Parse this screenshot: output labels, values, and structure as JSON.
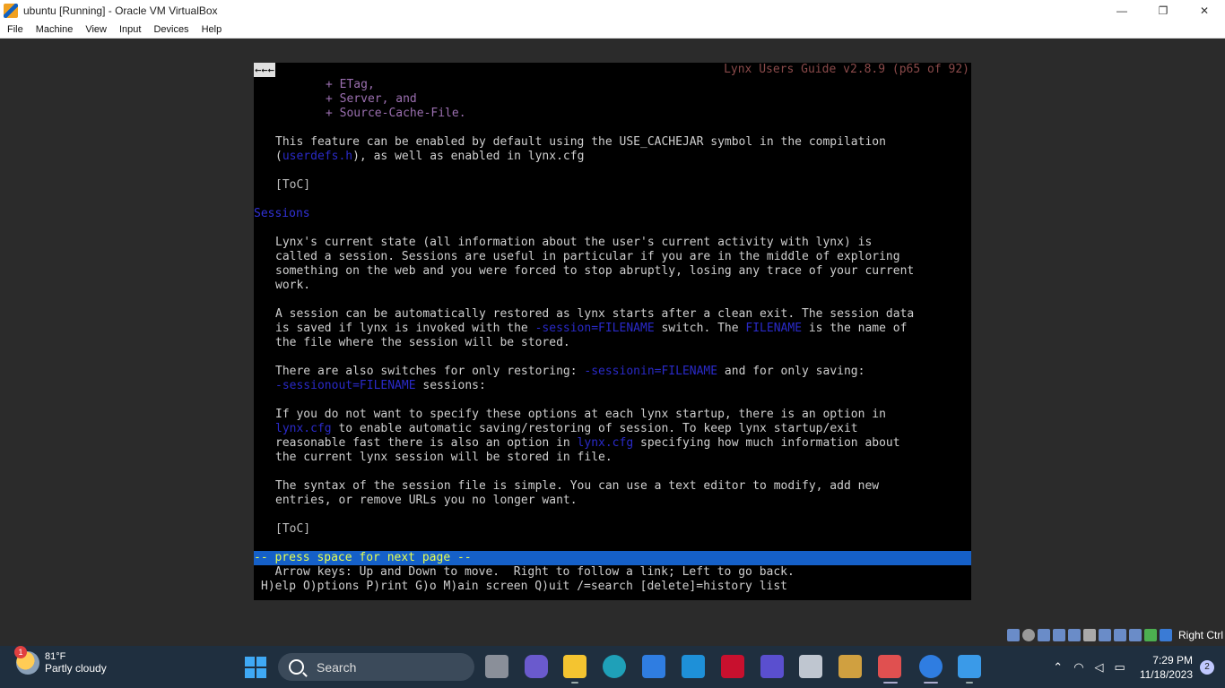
{
  "window": {
    "title": "ubuntu [Running] - Oracle VM VirtualBox",
    "minimize": "—",
    "restore": "❐",
    "close": "✕"
  },
  "menu": [
    "File",
    "Machine",
    "View",
    "Input",
    "Devices",
    "Help"
  ],
  "lynx": {
    "back_arrows": "←←←",
    "page_title": "Lynx Users Guide v2.8.9 (p65 of 92)",
    "list": [
      "+ ETag,",
      "+ Server, and",
      "+ Source-Cache-File."
    ],
    "para1_line1": "This feature can be enabled by default using the USE_CACHEJAR symbol in the compilation",
    "para1_line2_pre": "(",
    "para1_line2_link": "userdefs.h",
    "para1_line2_post": "), as well as enabled in lynx.cfg",
    "toc": "[ToC]",
    "heading": "Sessions",
    "para2": [
      "Lynx's current state (all information about the user's current activity with lynx) is",
      "called a session. Sessions are useful in particular if you are in the middle of exploring",
      "something on the web and you were forced to stop abruptly, losing any trace of your current",
      "work."
    ],
    "para3_line1": "A session can be automatically restored as lynx starts after a clean exit. The session data",
    "para3_line2_a": "is saved if lynx is invoked with the ",
    "para3_line2_link1": "-session=FILENAME",
    "para3_line2_b": " switch. The ",
    "para3_line2_link2": "FILENAME",
    "para3_line2_c": " is the name of",
    "para3_line3": "the file where the session will be stored.",
    "para4_line1_a": "There are also switches for only restoring: ",
    "para4_line1_link": "-sessionin=FILENAME",
    "para4_line1_b": " and for only saving:",
    "para4_line2_link": "-sessionout=FILENAME",
    "para4_line2_b": " sessions:",
    "para5_line1": "If you do not want to specify these options at each lynx startup, there is an option in",
    "para5_line2_link": "lynx.cfg",
    "para5_line2_b": " to enable automatic saving/restoring of session. To keep lynx startup/exit",
    "para5_line3_a": "reasonable fast there is also an option in ",
    "para5_line3_link": "lynx.cfg",
    "para5_line3_b": " specifying how much information about",
    "para5_line4": "the current lynx session will be stored in file.",
    "para6_line1": "The syntax of the session file is simple. You can use a text editor to modify, add new",
    "para6_line2": "entries, or remove URLs you no longer want.",
    "status": "-- press space for next page --",
    "help1": "  Arrow keys: Up and Down to move.  Right to follow a link; Left to go back.",
    "help2": "H)elp O)ptions P)rint G)o M)ain screen Q)uit /=search [delete]=history list"
  },
  "vbox_status": {
    "host_key": "Right Ctrl"
  },
  "taskbar": {
    "weather_temp": "81°F",
    "weather_cond": "Partly cloudy",
    "weather_badge": "1",
    "search_label": "Search",
    "time": "7:29 PM",
    "date": "11/18/2023",
    "notifications": "2"
  }
}
